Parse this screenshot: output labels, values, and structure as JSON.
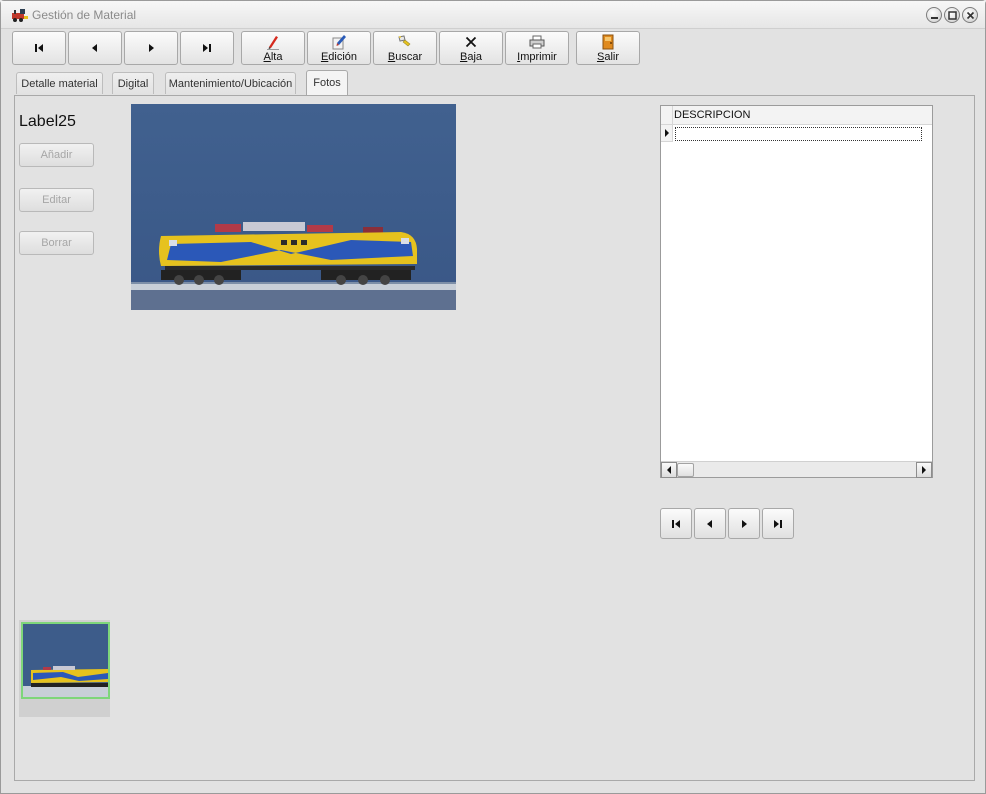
{
  "window": {
    "title": "Gestión de Material",
    "icon": "train-app-icon"
  },
  "toolbar": {
    "nav_buttons": [
      "first",
      "previous",
      "next",
      "last"
    ],
    "alta": {
      "prefix": "",
      "mnemonic": "A",
      "suffix": "lta"
    },
    "edicion": {
      "prefix": "",
      "mnemonic": "E",
      "suffix": "dición"
    },
    "buscar": {
      "prefix": "",
      "mnemonic": "B",
      "suffix": "uscar"
    },
    "baja": {
      "prefix": "",
      "mnemonic": "B",
      "suffix": "aja"
    },
    "imprimir": {
      "prefix": "",
      "mnemonic": "I",
      "suffix": "mprimir"
    },
    "salir": {
      "prefix": "",
      "mnemonic": "S",
      "suffix": "alir"
    }
  },
  "tabs": [
    {
      "label": "Detalle material",
      "active": false
    },
    {
      "label": "Digital",
      "active": false
    },
    {
      "label": "Mantenimiento/Ubicación",
      "active": false
    },
    {
      "label": "Fotos",
      "active": true
    }
  ],
  "fotos": {
    "label": "Label25",
    "buttons": {
      "add": "Añadir",
      "edit": "Editar",
      "delete": "Borrar"
    }
  },
  "grid": {
    "column": "DESCRIPCION",
    "rows": [
      ""
    ]
  },
  "colors": {
    "photo_background": "#3f5e8c",
    "locomotive_yellow": "#e6c21e",
    "locomotive_blue": "#2b58b8",
    "thumb_border": "#7ed67a"
  }
}
